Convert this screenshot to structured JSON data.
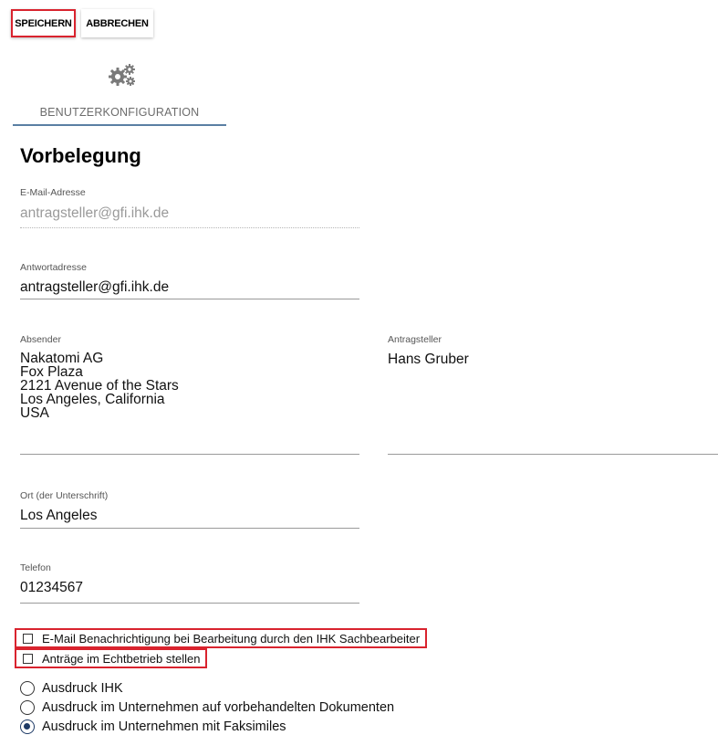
{
  "toolbar": {
    "save_label": "SPEICHERN",
    "cancel_label": "ABBRECHEN"
  },
  "tab": {
    "label": "BENUTZERKONFIGURATION",
    "icon": "gears-icon"
  },
  "section": {
    "title": "Vorbelegung"
  },
  "fields": {
    "email": {
      "label": "E-Mail-Adresse",
      "value": "antragsteller@gfi.ihk.de",
      "disabled": true
    },
    "reply": {
      "label": "Antwortadresse",
      "value": "antragsteller@gfi.ihk.de"
    },
    "sender": {
      "label": "Absender",
      "lines": [
        "Nakatomi AG",
        "Fox Plaza",
        "2121 Avenue of the Stars",
        "Los Angeles, California",
        "USA"
      ]
    },
    "applicant": {
      "label": "Antragsteller",
      "value": "Hans Gruber"
    },
    "place": {
      "label": "Ort (der Unterschrift)",
      "value": "Los Angeles"
    },
    "phone": {
      "label": "Telefon",
      "value": "01234567"
    }
  },
  "checkboxes": [
    {
      "label": "E-Mail Benachrichtigung bei Bearbeitung durch den IHK Sachbearbeiter",
      "checked": false
    },
    {
      "label": "Anträge im Echtbetrieb stellen",
      "checked": false
    }
  ],
  "radios": [
    {
      "label": "Ausdruck IHK",
      "selected": false
    },
    {
      "label": "Ausdruck im Unternehmen auf vorbehandelten Dokumenten",
      "selected": false
    },
    {
      "label": "Ausdruck im Unternehmen mit Faksimiles",
      "selected": true
    }
  ],
  "colors": {
    "highlight": "#d9232e",
    "tab_underline": "#5a7fa3",
    "radio_selected": "#1e3a66"
  }
}
